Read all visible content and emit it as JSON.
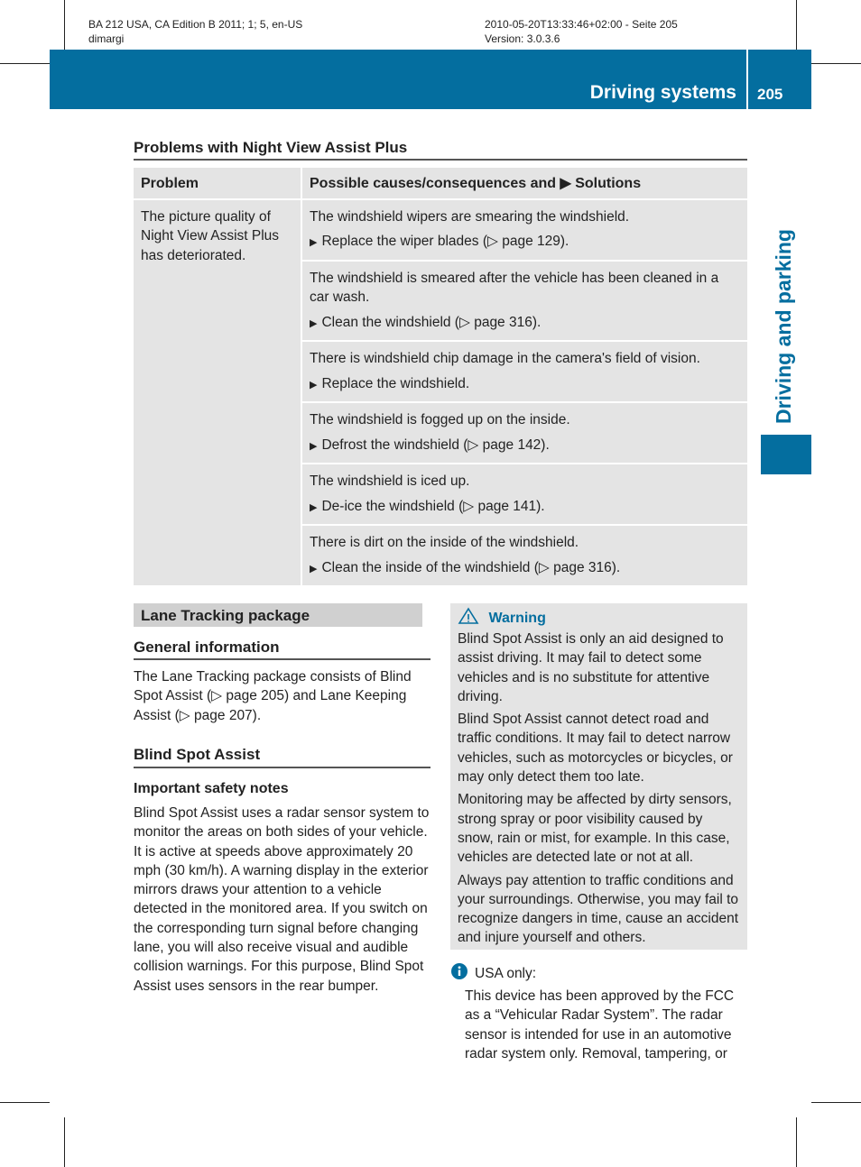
{
  "meta": {
    "left1": "BA 212 USA, CA Edition B 2011; 1; 5, en-US",
    "left2": "dimargi",
    "right1": "2010-05-20T13:33:46+02:00 - Seite 205",
    "right2": "Version: 3.0.3.6"
  },
  "header": {
    "section": "Driving systems",
    "page": "205",
    "side_tab": "Driving and parking"
  },
  "problems": {
    "title": "Problems with Night View Assist Plus",
    "col1": "Problem",
    "col2": "Possible causes/consequences and ▶ Solutions",
    "problem": "The picture quality of Night View Assist Plus has deteriorated.",
    "rows": [
      {
        "cause": "The windshield wipers are smearing the windshield.",
        "solution": "Replace the wiper blades (▷ page 129)."
      },
      {
        "cause": "The windshield is smeared after the vehicle has been cleaned in a car wash.",
        "solution": "Clean the windshield (▷ page 316)."
      },
      {
        "cause": "There is windshield chip damage in the camera's field of vision.",
        "solution": "Replace the windshield."
      },
      {
        "cause": "The windshield is fogged up on the inside.",
        "solution": "Defrost the windshield (▷ page 142)."
      },
      {
        "cause": "The windshield is iced up.",
        "solution": "De-ice the windshield (▷ page 141)."
      },
      {
        "cause": "There is dirt on the inside of the windshield.",
        "solution": "Clean the inside of the windshield (▷ page 316)."
      }
    ]
  },
  "lane": {
    "title": "Lane Tracking package",
    "general_title": "General information",
    "general_text": "The Lane Tracking package consists of Blind Spot Assist (▷ page 205) and Lane Keeping Assist (▷ page 207).",
    "bsa_title": "Blind Spot Assist",
    "safety_title": "Important safety notes",
    "safety_text": "Blind Spot Assist uses a radar sensor system to monitor the areas on both sides of your vehicle. It is active at speeds above approximately 20 mph (30 km/h). A warning display in the exterior mirrors draws your attention to a vehicle detected in the monitored area. If you switch on the corresponding turn signal before changing lane, you will also receive visual and audible collision warnings. For this purpose, Blind Spot Assist uses sensors in the rear bumper."
  },
  "warning": {
    "title": "Warning",
    "paragraphs": [
      "Blind Spot Assist is only an aid designed to assist driving. It may fail to detect some vehicles and is no substitute for attentive driving.",
      "Blind Spot Assist cannot detect road and traffic conditions. It may fail to detect narrow vehicles, such as motorcycles or bicycles, or may only detect them too late.",
      "Monitoring may be affected by dirty sensors, strong spray or poor visibility caused by snow, rain or mist, for example. In this case, vehicles are detected late or not at all.",
      "Always pay attention to traffic conditions and your surroundings. Otherwise, you may fail to recognize dangers in time, cause an accident and injure yourself and others."
    ]
  },
  "info": {
    "title": "USA only:",
    "text": "This device has been approved by the FCC as a “Vehicular Radar System”. The radar sensor is intended for use in an automotive radar system only. Removal, tampering, or"
  },
  "colors": {
    "brand": "#046e9f",
    "panel": "#e4e4e4"
  }
}
